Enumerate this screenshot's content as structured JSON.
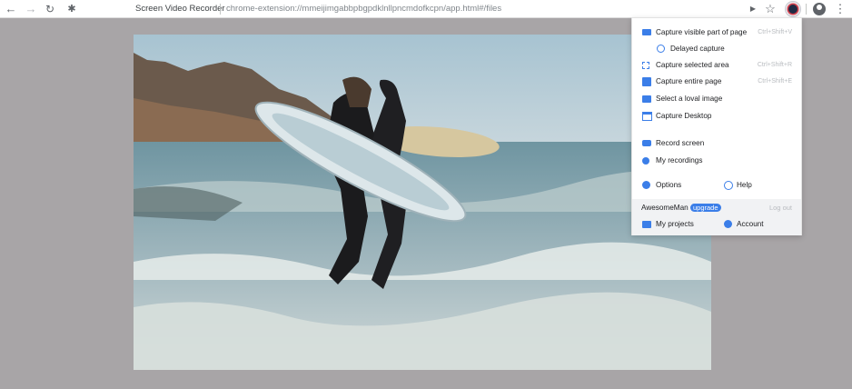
{
  "browser": {
    "tab_title": "Screen Video Recorder",
    "url": "chrome-extension://mmeijimgabbpbgpdklnllpncmdofkcpn/app.html#/files",
    "colors": {
      "toolbar": "#ffffff",
      "page_background": "#a8a5a7"
    }
  },
  "icons": {
    "back": "←",
    "forward": "→",
    "reload": "↻",
    "extensions": "✱",
    "camera": "▶",
    "star": "☆",
    "menu": "⋮"
  },
  "menu": {
    "capture_visible": {
      "label": "Capture visible part of page",
      "shortcut": "Ctrl+Shift+V"
    },
    "delayed_capture": {
      "label": "Delayed capture"
    },
    "capture_selected": {
      "label": "Capture selected area",
      "shortcut": "Ctrl+Shift+R"
    },
    "capture_entire": {
      "label": "Capture entire page",
      "shortcut": "Ctrl+Shift+E"
    },
    "select_local": {
      "label": "Select a loval image"
    },
    "capture_desktop": {
      "label": "Capture Desktop"
    },
    "record_screen": {
      "label": "Record screen"
    },
    "my_recordings": {
      "label": "My recordings"
    },
    "options": {
      "label": "Options"
    },
    "help": {
      "label": "Help"
    },
    "user": {
      "name": "AwesomeMan",
      "badge": "upgrade",
      "logout": "Log out"
    },
    "my_projects": {
      "label": "My projects"
    },
    "account": {
      "label": "Account"
    },
    "accent_color": "#3b7ee8"
  }
}
